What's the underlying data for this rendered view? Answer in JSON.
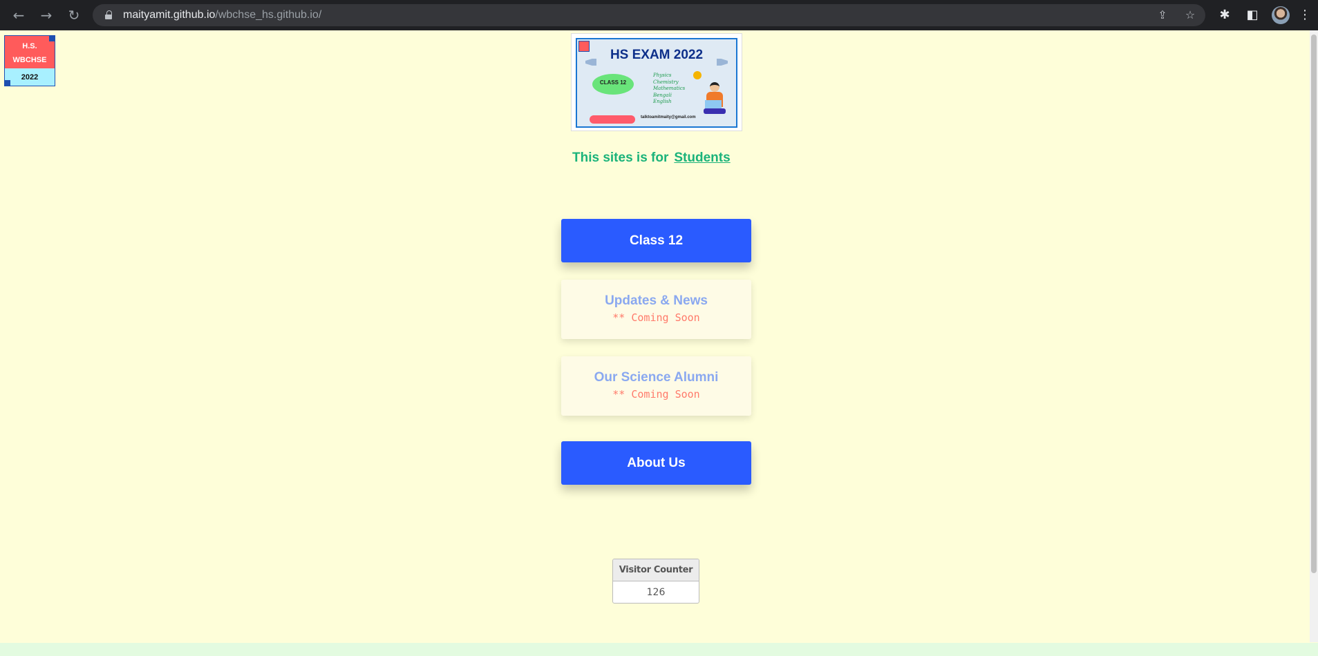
{
  "browser": {
    "url_host": "maityamit.github.io",
    "url_path": "/wbchse_hs.github.io/"
  },
  "badge": {
    "line1": "H.S.",
    "line2": "WBCHSE",
    "year": "2022"
  },
  "banner": {
    "title": "HS EXAM 2022",
    "class_label": "CLASS 12",
    "subjects": [
      "Physics",
      "Chemistry",
      "Mathematics",
      "Bengali",
      "English"
    ],
    "email": "talktoamitmaity@gmail.com"
  },
  "tagline": {
    "text": "This sites is for",
    "link": "Students"
  },
  "menu": {
    "class12": "Class 12",
    "updates": {
      "label": "Updates & News",
      "note": "** Coming Soon"
    },
    "alumni": {
      "label": "Our Science Alumni",
      "note": "** Coming Soon"
    },
    "about": "About Us"
  },
  "counter": {
    "title": "Visitor Counter",
    "value": "126"
  }
}
